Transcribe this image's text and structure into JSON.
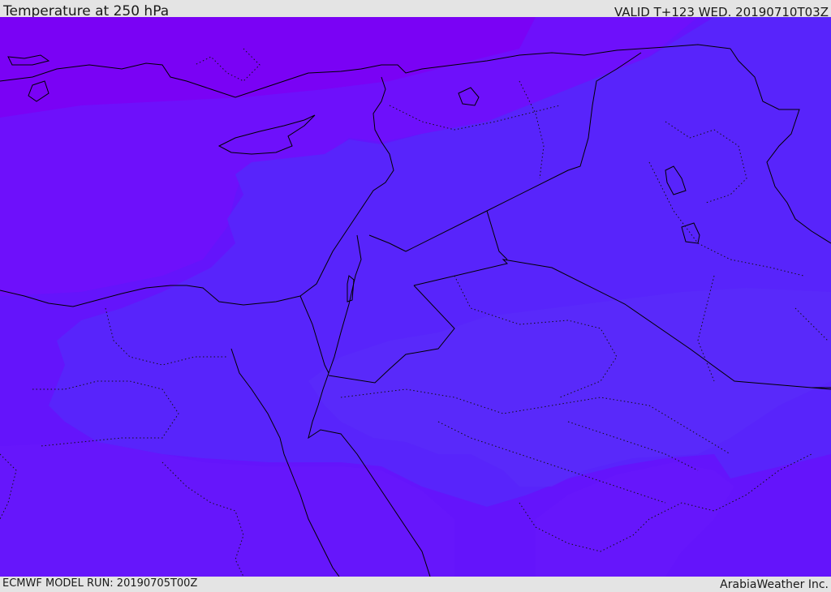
{
  "header": {
    "title": "Temperature at 250 hPa",
    "valid": "VALID T+123 WED. 20190710T03Z"
  },
  "footer": {
    "model_run": "ECMWF MODEL RUN: 20190705T00Z",
    "credit": "ArabiaWeather Inc."
  },
  "map": {
    "field": "Temperature at 250 hPa",
    "fill_colors": {
      "coldest_north": "#7b00f5",
      "cold_north": "#6e10fb",
      "mid": "#5a24fb",
      "warm_core": "#5b2afa",
      "south": "#6414fb"
    },
    "border_color": "#000000"
  }
}
